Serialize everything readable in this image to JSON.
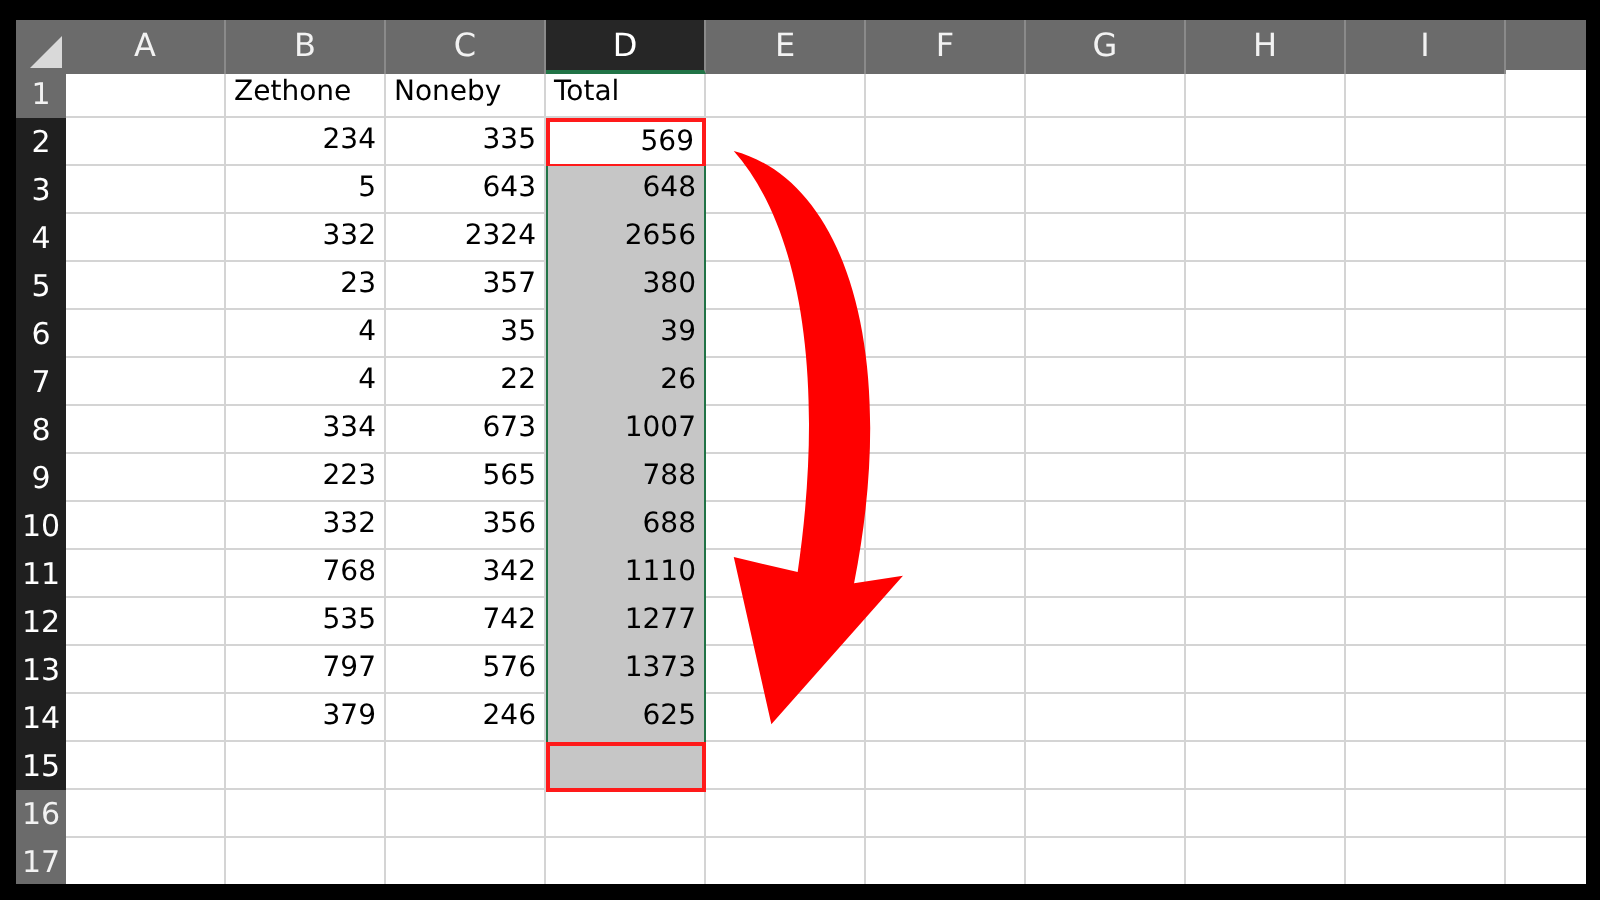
{
  "columns": [
    {
      "label": "A",
      "selected": false
    },
    {
      "label": "B",
      "selected": false
    },
    {
      "label": "C",
      "selected": false
    },
    {
      "label": "D",
      "selected": true
    },
    {
      "label": "E",
      "selected": false
    },
    {
      "label": "F",
      "selected": false
    },
    {
      "label": "G",
      "selected": false
    },
    {
      "label": "H",
      "selected": false
    },
    {
      "label": "I",
      "selected": false
    }
  ],
  "rows": [
    {
      "number": "1",
      "selected": false,
      "b": "Zethone",
      "c": "Noneby",
      "d": "Total",
      "d_shaded": false,
      "d_outlined": false
    },
    {
      "number": "2",
      "selected": true,
      "b": "234",
      "c": "335",
      "d": "569",
      "d_shaded": false,
      "d_outlined": true
    },
    {
      "number": "3",
      "selected": true,
      "b": "5",
      "c": "643",
      "d": "648",
      "d_shaded": true,
      "d_outlined": false
    },
    {
      "number": "4",
      "selected": true,
      "b": "332",
      "c": "2324",
      "d": "2656",
      "d_shaded": true,
      "d_outlined": false
    },
    {
      "number": "5",
      "selected": true,
      "b": "23",
      "c": "357",
      "d": "380",
      "d_shaded": true,
      "d_outlined": false
    },
    {
      "number": "6",
      "selected": true,
      "b": "4",
      "c": "35",
      "d": "39",
      "d_shaded": true,
      "d_outlined": false
    },
    {
      "number": "7",
      "selected": true,
      "b": "4",
      "c": "22",
      "d": "26",
      "d_shaded": true,
      "d_outlined": false
    },
    {
      "number": "8",
      "selected": true,
      "b": "334",
      "c": "673",
      "d": "1007",
      "d_shaded": true,
      "d_outlined": false
    },
    {
      "number": "9",
      "selected": true,
      "b": "223",
      "c": "565",
      "d": "788",
      "d_shaded": true,
      "d_outlined": false
    },
    {
      "number": "10",
      "selected": true,
      "b": "332",
      "c": "356",
      "d": "688",
      "d_shaded": true,
      "d_outlined": false
    },
    {
      "number": "11",
      "selected": true,
      "b": "768",
      "c": "342",
      "d": "1110",
      "d_shaded": true,
      "d_outlined": false
    },
    {
      "number": "12",
      "selected": true,
      "b": "535",
      "c": "742",
      "d": "1277",
      "d_shaded": true,
      "d_outlined": false
    },
    {
      "number": "13",
      "selected": true,
      "b": "797",
      "c": "576",
      "d": "1373",
      "d_shaded": true,
      "d_outlined": false
    },
    {
      "number": "14",
      "selected": true,
      "b": "379",
      "c": "246",
      "d": "625",
      "d_shaded": true,
      "d_outlined": false
    },
    {
      "number": "15",
      "selected": true,
      "d_shaded": true,
      "d_outlined": true
    },
    {
      "number": "16",
      "selected": false,
      "d_shaded": false,
      "d_outlined": false
    },
    {
      "number": "17",
      "selected": false,
      "d_shaded": false,
      "d_outlined": false
    }
  ]
}
